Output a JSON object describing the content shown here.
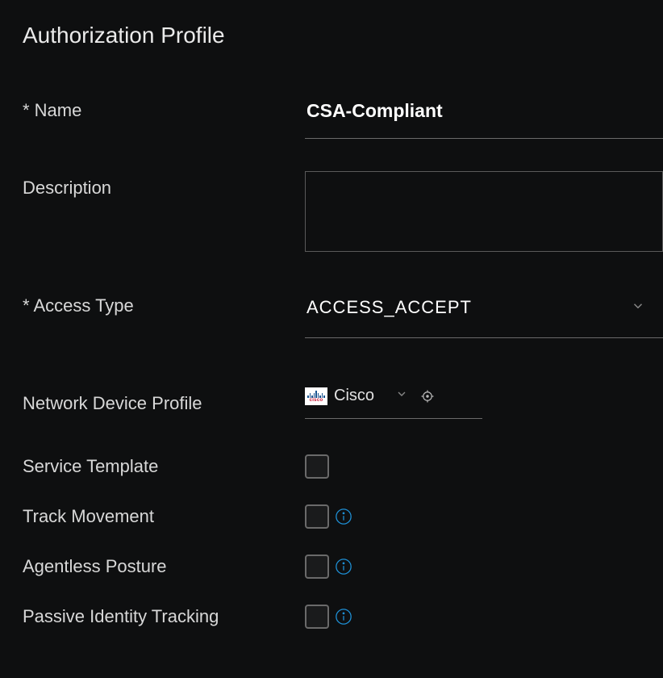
{
  "header": {
    "title": "Authorization Profile"
  },
  "form": {
    "name_label": "* Name",
    "name_value": "CSA-Compliant",
    "description_label": "Description",
    "description_value": "",
    "access_type_label": "* Access Type",
    "access_type_value": "ACCESS_ACCEPT",
    "network_device_profile_label": "Network Device Profile",
    "network_device_profile_value": "Cisco",
    "service_template_label": "Service Template",
    "service_template_checked": false,
    "track_movement_label": "Track Movement",
    "track_movement_checked": false,
    "agentless_posture_label": "Agentless Posture",
    "agentless_posture_checked": false,
    "passive_identity_tracking_label": "Passive Identity Tracking",
    "passive_identity_tracking_checked": false
  },
  "icons": {
    "cisco_wordmark": "cisco",
    "info": "i"
  }
}
